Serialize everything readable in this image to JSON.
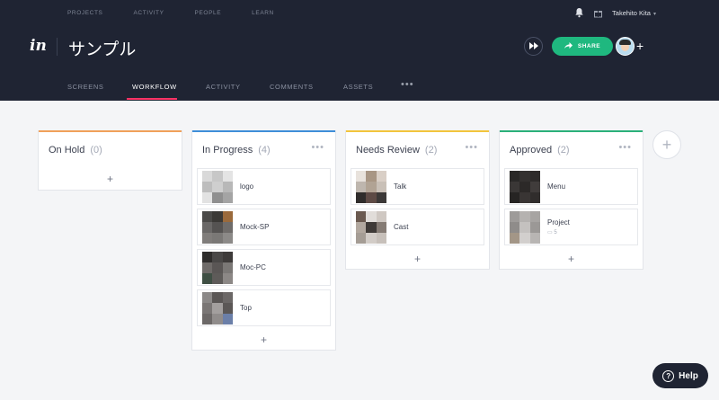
{
  "topnav": {
    "items": [
      "PROJECTS",
      "ACTIVITY",
      "PEOPLE",
      "LEARN"
    ],
    "user_name": "Takehito Kita"
  },
  "brand": {
    "logo_text": "in"
  },
  "project": {
    "title": "サンプル"
  },
  "actions": {
    "share_label": "SHARE"
  },
  "tabs": [
    "SCREENS",
    "WORKFLOW",
    "ACTIVITY",
    "COMMENTS",
    "ASSETS"
  ],
  "active_tab": "WORKFLOW",
  "columns": [
    {
      "title": "On Hold",
      "count": "(0)",
      "accent": "#f0a15a",
      "cards": []
    },
    {
      "title": "In Progress",
      "count": "(4)",
      "accent": "#3f8ed8",
      "cards": [
        {
          "label": "logo",
          "colors": [
            "#d9d9d9",
            "#c7c7c7",
            "#e4e4e4",
            "#bdbdbd",
            "#cfcfcf",
            "#b8b8b8",
            "#e2e2e2",
            "#8f8f8f",
            "#a4a4a4"
          ]
        },
        {
          "label": "Mock-SP",
          "colors": [
            "#4b4a48",
            "#3b3936",
            "#9a6a3c",
            "#6a6867",
            "#555352",
            "#6f6c6a",
            "#807d7b",
            "#7a7876",
            "#8c8a88"
          ]
        },
        {
          "label": "Moc-PC",
          "colors": [
            "#2f2d2c",
            "#4a4847",
            "#3e3b3a",
            "#6f6b69",
            "#5a5655",
            "#7b7876",
            "#3f4f44",
            "#5e5b59",
            "#8c8886"
          ]
        },
        {
          "label": "Top",
          "colors": [
            "#8b8887",
            "#5a5655",
            "#6b6766",
            "#7a7675",
            "#a39f9e",
            "#5b5756",
            "#6c6867",
            "#908c8b",
            "#6b7fa8"
          ]
        }
      ]
    },
    {
      "title": "Needs Review",
      "count": "(2)",
      "accent": "#f2c53d",
      "cards": [
        {
          "label": "Talk",
          "colors": [
            "#e8e2dc",
            "#a89684",
            "#d9cfc6",
            "#beb6ae",
            "#b1a394",
            "#c9c0b7",
            "#2f2c2b",
            "#5d4a45",
            "#3b3837"
          ]
        },
        {
          "label": "Cast",
          "colors": [
            "#6b5a50",
            "#e1ddd9",
            "#cfc8c2",
            "#b2a89f",
            "#3f3a37",
            "#857b74",
            "#a59d95",
            "#d2ccc7",
            "#c7c0ba"
          ]
        }
      ]
    },
    {
      "title": "Approved",
      "count": "(2)",
      "accent": "#2bb07a",
      "cards": [
        {
          "label": "Menu",
          "comments": "",
          "colors": [
            "#2a2827",
            "#343130",
            "#2e2b2a",
            "#3a3736",
            "#2c2928",
            "#403c3b",
            "#262423",
            "#393534",
            "#302d2c"
          ]
        },
        {
          "label": "Project",
          "comments": "5",
          "colors": [
            "#9e9b99",
            "#b5b2b0",
            "#a7a4a2",
            "#8f8c8a",
            "#c4c1bf",
            "#9b9896",
            "#a39687",
            "#d2cfcd",
            "#b8b5b3"
          ]
        }
      ]
    }
  ],
  "help": {
    "label": "Help"
  }
}
